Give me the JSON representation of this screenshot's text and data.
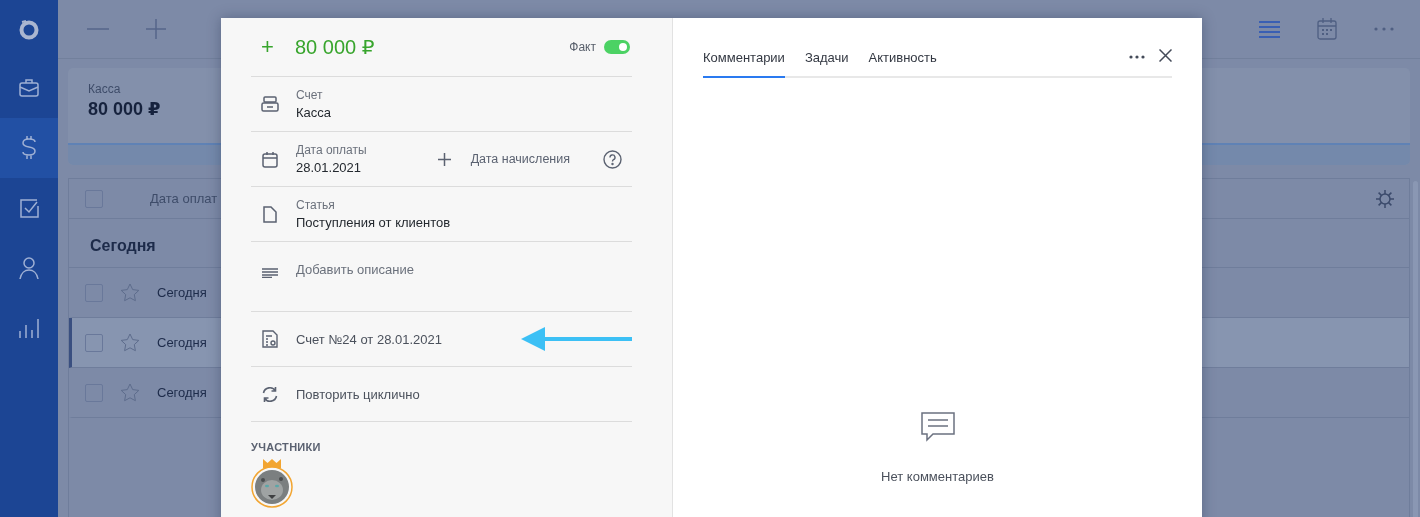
{
  "sidebar": {
    "items": [
      {
        "kind": "logo",
        "selected": false
      },
      {
        "kind": "briefcase",
        "selected": false
      },
      {
        "kind": "dollar",
        "selected": true
      },
      {
        "kind": "tasks",
        "selected": false
      },
      {
        "kind": "person",
        "selected": false
      },
      {
        "kind": "chart",
        "selected": false
      }
    ]
  },
  "toolbar": {
    "views": [
      {
        "kind": "list",
        "selected": true
      },
      {
        "kind": "calendar",
        "selected": false
      }
    ]
  },
  "summary_card": {
    "label": "Касса",
    "amount": "80 000 ₽"
  },
  "table": {
    "header": {
      "checked": false,
      "column_1": "Дата оплат"
    },
    "group": "Сегодня",
    "rows": [
      {
        "checked": false,
        "starred": false,
        "selected": false,
        "date": "Сегодня"
      },
      {
        "checked": false,
        "starred": false,
        "selected": true,
        "date": "Сегодня"
      },
      {
        "checked": false,
        "starred": false,
        "selected": false,
        "date": "Сегодня"
      }
    ]
  },
  "operation": {
    "sign": "+",
    "amount": "80 000 ₽",
    "fact": {
      "label": "Факт",
      "on": true
    },
    "fields": [
      {
        "kind": "account",
        "label": "Счет",
        "value": "Касса"
      },
      {
        "kind": "date",
        "label": "Дата оплаты",
        "value": "28.01.2021",
        "extra": "Дата начисления"
      },
      {
        "kind": "article",
        "label": "Статья",
        "value": "Поступления от клиентов"
      },
      {
        "kind": "description",
        "placeholder": "Добавить описание"
      },
      {
        "kind": "invoice",
        "value": "Счет №24 от 28.01.2021",
        "pointer": true
      },
      {
        "kind": "repeat",
        "value": "Повторить циклично"
      }
    ],
    "participants": {
      "title": "УЧАСТНИКИ",
      "people": [
        {
          "kind": "picture",
          "owner": true
        }
      ]
    }
  },
  "side_panel": {
    "tabs": [
      {
        "label": "Комментарии",
        "selected": true
      },
      {
        "label": "Задачи",
        "selected": false
      },
      {
        "label": "Активность",
        "selected": false
      }
    ],
    "empty_text": "Нет комментариев"
  }
}
